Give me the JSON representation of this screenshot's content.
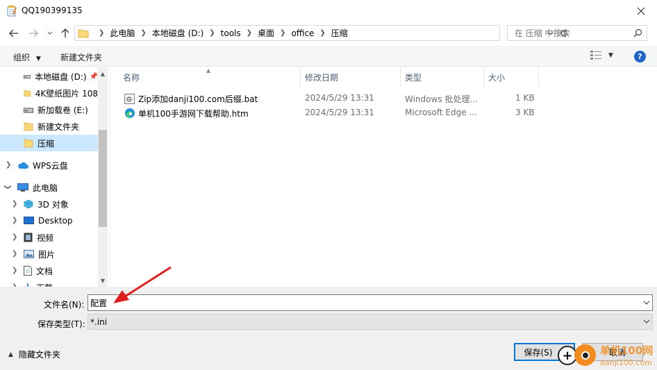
{
  "window": {
    "title": "QQ190399135"
  },
  "address": {
    "crumbs": [
      "此电脑",
      "本地磁盘 (D:)",
      "tools",
      "桌面",
      "office",
      "压缩"
    ],
    "search_placeholder": "在 压缩 中搜索"
  },
  "toolbar": {
    "organize": "组织",
    "new_folder": "新建文件夹"
  },
  "nav": {
    "items": [
      {
        "label": "本地磁盘 (D:)",
        "icon": "drive-icon"
      },
      {
        "label": "4K壁纸图片 108",
        "icon": "folder-icon"
      },
      {
        "label": "新加载卷 (E:)",
        "icon": "drive-icon"
      },
      {
        "label": "新建文件夹",
        "icon": "folder-icon"
      },
      {
        "label": "压缩",
        "icon": "folder-icon",
        "selected": true
      },
      {
        "label": "WPS云盘",
        "icon": "cloud-icon"
      },
      {
        "label": "此电脑",
        "icon": "computer-icon"
      },
      {
        "label": "3D 对象",
        "icon": "3d-objects-icon"
      },
      {
        "label": "Desktop",
        "icon": "desktop-icon"
      },
      {
        "label": "视频",
        "icon": "video-icon"
      },
      {
        "label": "图片",
        "icon": "pictures-icon"
      },
      {
        "label": "文档",
        "icon": "documents-icon"
      },
      {
        "label": "下载",
        "icon": "downloads-icon"
      }
    ]
  },
  "list": {
    "columns": [
      "名称",
      "修改日期",
      "类型",
      "大小"
    ],
    "rows": [
      {
        "name": "Zip添加danji100.com后缀.bat",
        "date": "2024/5/29 13:31",
        "type": "Windows 批处理...",
        "size": "1 KB",
        "icon": "batch-file-icon"
      },
      {
        "name": "单机100手游网下载帮助.htm",
        "date": "2024/5/29 13:31",
        "type": "Microsoft Edge ...",
        "size": "3 KB",
        "icon": "edge-icon"
      }
    ]
  },
  "bottom": {
    "filename_label": "文件名(N):",
    "filename_value": "配置",
    "filetype_label": "保存类型(T):",
    "filetype_value": "*.ini",
    "hide_folders": "隐藏文件夹",
    "save_button": "保存(S)",
    "cancel_button": "取消"
  },
  "watermark": {
    "line1": "单机100网",
    "line2": "danji100.com"
  },
  "colors": {
    "accent": "#0078d7",
    "selection": "#cce8ff",
    "annotation_arrow": "#e0201c",
    "watermark": "#f28c1f"
  }
}
